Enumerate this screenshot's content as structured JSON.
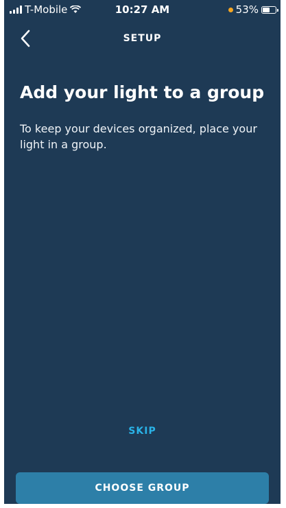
{
  "status_bar": {
    "carrier": "T-Mobile",
    "time": "10:27 AM",
    "battery": "53%",
    "battery_level": 0.53,
    "icons": [
      "signal-icon",
      "wifi-icon",
      "battery-icon"
    ]
  },
  "nav": {
    "title": "SETUP",
    "back_icon": "chevron-left-icon"
  },
  "main": {
    "heading": "Add your light to a group",
    "description": "To keep your devices organized, place your light in a group."
  },
  "actions": {
    "skip_label": "SKIP",
    "choose_label": "CHOOSE GROUP"
  },
  "colors": {
    "background": "#1e3a55",
    "accent": "#2ab3e8",
    "button": "#2d7fa8"
  }
}
